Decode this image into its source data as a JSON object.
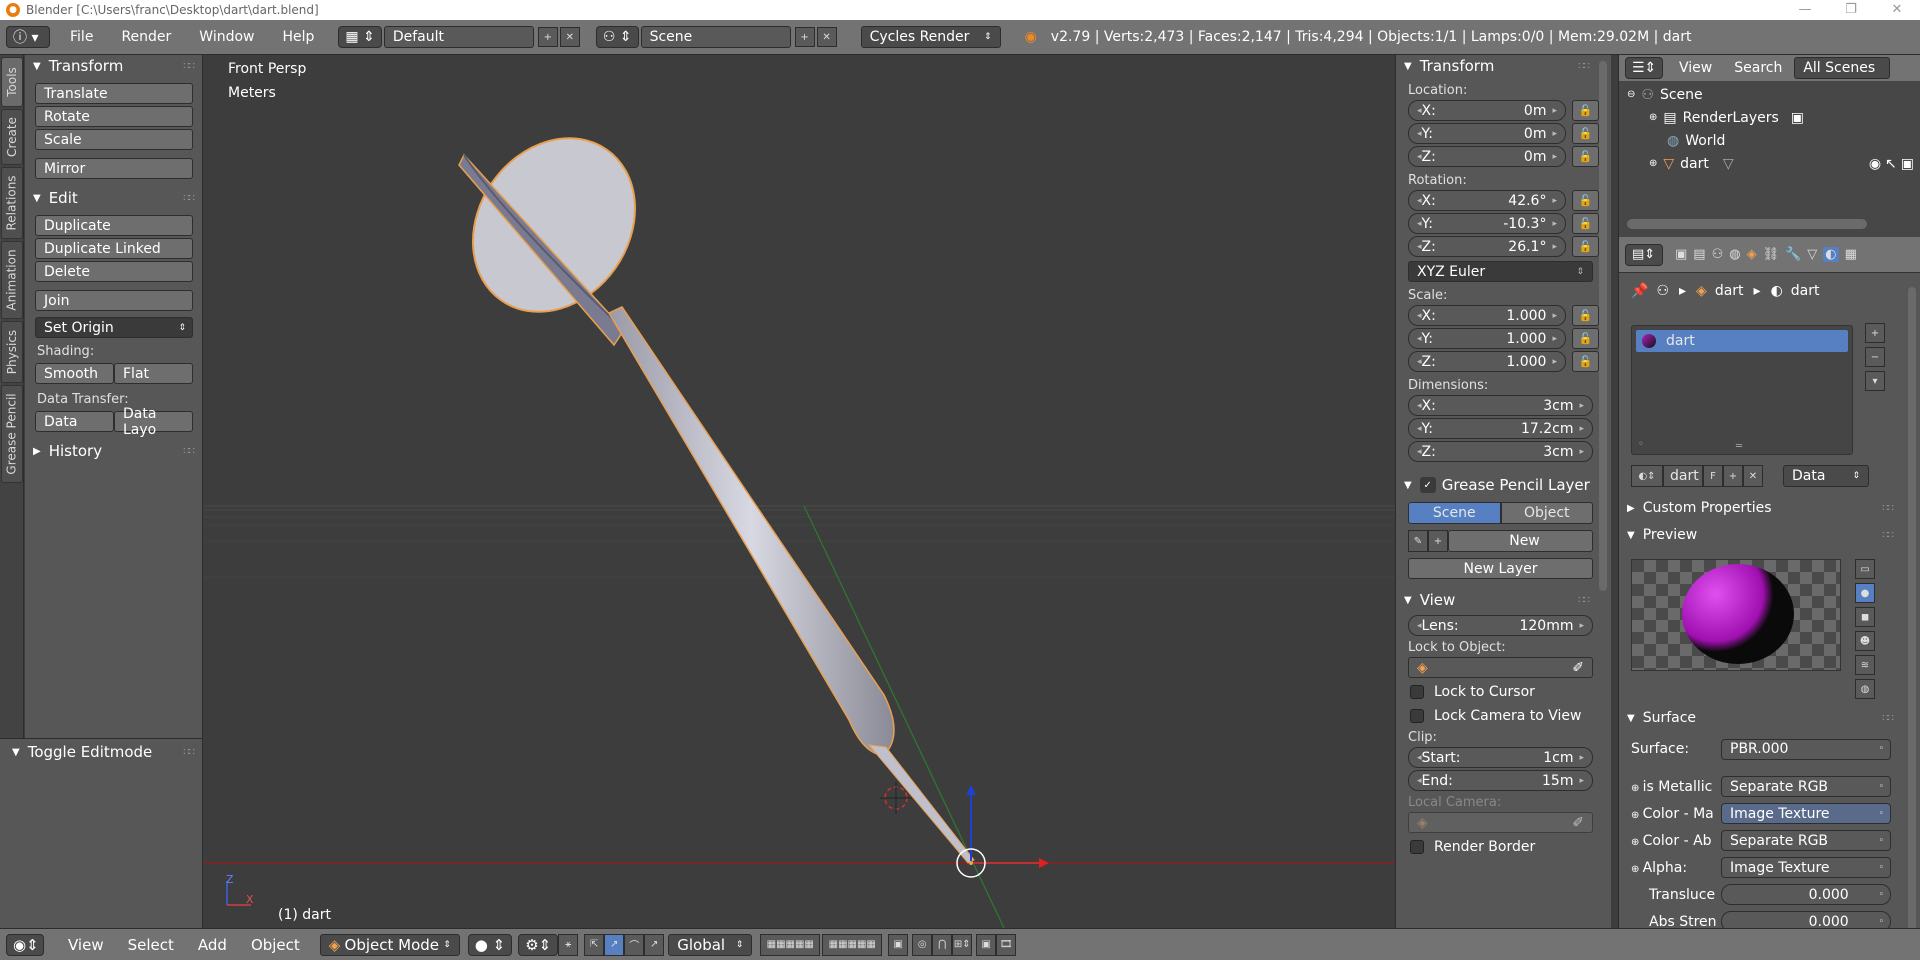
{
  "window": {
    "title": "Blender [C:\\Users\\franc\\Desktop\\dart\\dart.blend]",
    "minimize": "—",
    "maximize": "❐",
    "close": "✕"
  },
  "infobar": {
    "menus": [
      "File",
      "Render",
      "Window",
      "Help"
    ],
    "screen_layout": "Default",
    "scene": "Scene",
    "render_engine": "Cycles Render",
    "stats": "v2.79 | Verts:2,473 | Faces:2,147 | Tris:4,294 | Objects:1/1 | Lamps:0/0 | Mem:29.02M | dart"
  },
  "tool_tabs": [
    "Tools",
    "Create",
    "Relations",
    "Animation",
    "Physics",
    "Grease Pencil"
  ],
  "tool_shelf": {
    "transform": {
      "title": "Transform",
      "translate": "Translate",
      "rotate": "Rotate",
      "scale": "Scale",
      "mirror": "Mirror"
    },
    "edit": {
      "title": "Edit",
      "duplicate": "Duplicate",
      "duplicate_linked": "Duplicate Linked",
      "delete": "Delete",
      "join": "Join",
      "set_origin": "Set Origin",
      "shading_label": "Shading:",
      "smooth": "Smooth",
      "flat": "Flat",
      "data_transfer_label": "Data Transfer:",
      "data": "Data",
      "data_layout": "Data Layo"
    },
    "history": "History",
    "toggle_editmode": "Toggle Editmode"
  },
  "viewport": {
    "view_name": "Front Persp",
    "units": "Meters",
    "object_label": "(1) dart",
    "axis_z": "Z",
    "axis_x": "X"
  },
  "properties": {
    "transform_title": "Transform",
    "location_label": "Location:",
    "location": {
      "x": "X:",
      "xv": "0m",
      "y": "Y:",
      "yv": "0m",
      "z": "Z:",
      "zv": "0m"
    },
    "rotation_label": "Rotation:",
    "rotation": {
      "x": "X:",
      "xv": "42.6°",
      "y": "Y:",
      "yv": "-10.3°",
      "z": "Z:",
      "zv": "26.1°"
    },
    "rotation_mode": "XYZ Euler",
    "scale_label": "Scale:",
    "scale": {
      "x": "X:",
      "xv": "1.000",
      "y": "Y:",
      "yv": "1.000",
      "z": "Z:",
      "zv": "1.000"
    },
    "dimensions_label": "Dimensions:",
    "dimensions": {
      "x": "X:",
      "xv": "3cm",
      "y": "Y:",
      "yv": "17.2cm",
      "z": "Z:",
      "zv": "3cm"
    },
    "grease_title": "Grease Pencil Layer",
    "gp_scene": "Scene",
    "gp_object": "Object",
    "gp_new": "New",
    "gp_new_layer": "New Layer",
    "view_title": "View",
    "lens_label": "Lens:",
    "lens_value": "120mm",
    "lock_object_label": "Lock to Object:",
    "lock_cursor": "Lock to Cursor",
    "lock_camera": "Lock Camera to View",
    "clip_label": "Clip:",
    "clip_start_label": "Start:",
    "clip_start": "1cm",
    "clip_end_label": "End:",
    "clip_end": "15m",
    "local_camera_label": "Local Camera:",
    "render_border": "Render Border"
  },
  "outliner": {
    "view": "View",
    "search": "Search",
    "filter": "All Scenes",
    "items": [
      "Scene",
      "RenderLayers",
      "World",
      "dart"
    ]
  },
  "material": {
    "breadcrumb_object": "dart",
    "breadcrumb_material": "dart",
    "slot": "dart",
    "datablock": "dart",
    "fake_user": "F",
    "link": "Data",
    "custom_props": "Custom Properties",
    "preview": "Preview",
    "surface_title": "Surface",
    "surface_label": "Surface:",
    "surface_value": "PBR.000",
    "rows": [
      {
        "label": "is Metallic",
        "value": "Separate RGB"
      },
      {
        "label": "Color - Ma",
        "value": "Image Texture"
      },
      {
        "label": "Color - Ab",
        "value": "Separate RGB"
      },
      {
        "label": "Alpha:",
        "value": "Image Texture"
      }
    ],
    "translucency_label": "Transluce",
    "translucency_value": "0.000",
    "abs_label": "Abs Stren",
    "abs_value": "0.000"
  },
  "bottombar": {
    "menus": [
      "View",
      "Select",
      "Add",
      "Object"
    ],
    "mode": "Object Mode",
    "orientation": "Global"
  },
  "colors": {
    "selected": "#5680c2",
    "outline": "#f0a050",
    "x_axis": "#c03030",
    "y_axis": "#30a030",
    "z_axis": "#2040d0"
  }
}
